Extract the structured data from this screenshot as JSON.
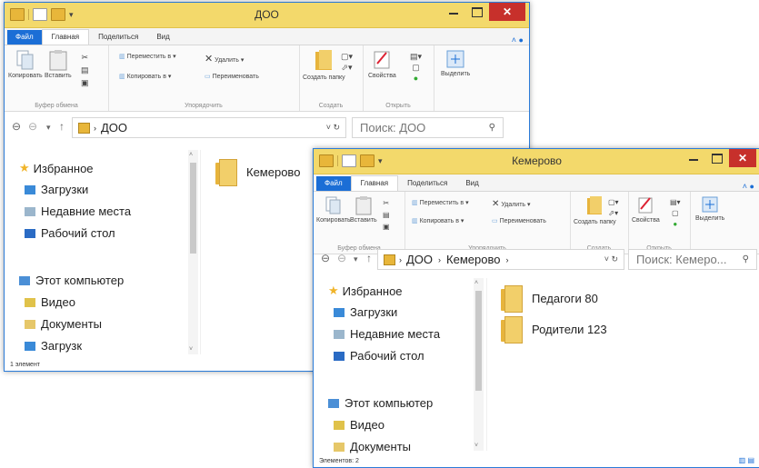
{
  "window1": {
    "title": "ДОО",
    "tabs": {
      "file": "Файл",
      "home": "Главная",
      "share": "Поделиться",
      "view": "Вид"
    },
    "ribbon": {
      "copy": "Копировать",
      "paste": "Вставить",
      "move_to": "Переместить в ▾",
      "copy_to": "Копировать в ▾",
      "delete": "Удалить ▾",
      "rename": "Переименовать",
      "new_folder": "Создать папку",
      "properties": "Свойства",
      "select": "Выделить",
      "group_clipboard": "Буфер обмена",
      "group_organize": "Упорядочить",
      "group_new": "Создать",
      "group_open": "Открыть"
    },
    "address": {
      "crumb": "ДОО"
    },
    "search_placeholder": "Поиск: ДОО",
    "nav": {
      "favorites": "Избранное",
      "downloads": "Загрузки",
      "recent": "Недавние места",
      "desktop": "Рабочий стол",
      "computer": "Этот компьютер",
      "video": "Видео",
      "documents": "Документы",
      "downloads2": "Загрузк"
    },
    "items": [
      "Кемерово"
    ],
    "status": "1 элемент"
  },
  "window2": {
    "title": "Кемерово",
    "tabs": {
      "file": "Файл",
      "home": "Главная",
      "share": "Поделиться",
      "view": "Вид"
    },
    "ribbon": {
      "copy": "Копировать",
      "paste": "Вставить",
      "move_to": "Переместить в ▾",
      "copy_to": "Копировать в ▾",
      "delete": "Удалить ▾",
      "rename": "Переименовать",
      "new_folder": "Создать папку",
      "properties": "Свойства",
      "select": "Выделить",
      "group_clipboard": "Буфер обмена",
      "group_organize": "Упорядочить",
      "group_new": "Создать",
      "group_open": "Открыть"
    },
    "address": {
      "crumb1": "ДОО",
      "crumb2": "Кемерово"
    },
    "search_placeholder": "Поиск: Кемеро...",
    "nav": {
      "favorites": "Избранное",
      "downloads": "Загрузки",
      "recent": "Недавние места",
      "desktop": "Рабочий стол",
      "computer": "Этот компьютер",
      "video": "Видео",
      "documents": "Документы"
    },
    "items": [
      "Педагоги 80",
      "Родители 123"
    ],
    "status": "Элементов: 2"
  },
  "colors": {
    "titlebar": "#f3d96b",
    "file_tab": "#1b6ed6",
    "close": "#c7302b",
    "folder": "#e7b43c"
  }
}
